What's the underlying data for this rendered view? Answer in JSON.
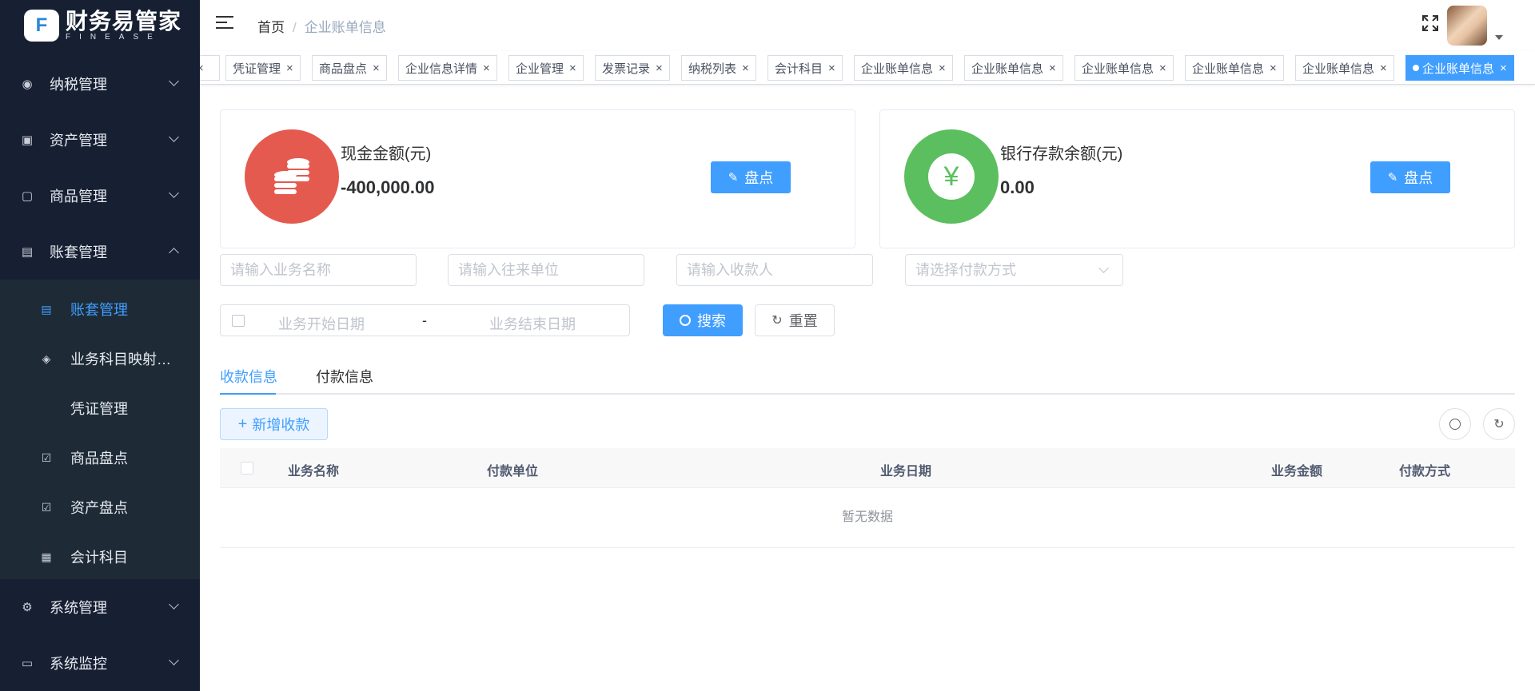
{
  "app": {
    "logo_letter": "F",
    "title": "财务易管家",
    "subtitle": "FINEASE"
  },
  "sidebar": {
    "menus": [
      {
        "label": "纳税管理",
        "icon": "eye-icon"
      },
      {
        "label": "资产管理",
        "icon": "camera-icon"
      },
      {
        "label": "商品管理",
        "icon": "image-icon"
      },
      {
        "label": "账套管理",
        "icon": "ledger-icon"
      },
      {
        "label": "系统管理",
        "icon": "gear-icon"
      },
      {
        "label": "系统监控",
        "icon": "monitor-icon"
      }
    ],
    "sub_items": [
      {
        "label": "账套管理",
        "icon": "ledger-icon"
      },
      {
        "label": "业务科目映射…",
        "icon": "layers-icon"
      },
      {
        "label": "凭证管理",
        "icon": ""
      },
      {
        "label": "商品盘点",
        "icon": "checkbox-icon"
      },
      {
        "label": "资产盘点",
        "icon": "checkbox-icon"
      },
      {
        "label": "会计科目",
        "icon": "calculator-icon"
      }
    ]
  },
  "header": {
    "breadcrumb": [
      "首页",
      "企业账单信息"
    ],
    "separator": "/"
  },
  "tags": [
    {
      "label": ""
    },
    {
      "label": "凭证管理"
    },
    {
      "label": "商品盘点"
    },
    {
      "label": "企业信息详情"
    },
    {
      "label": "企业管理"
    },
    {
      "label": "发票记录"
    },
    {
      "label": "纳税列表"
    },
    {
      "label": "会计科目"
    },
    {
      "label": "企业账单信息"
    },
    {
      "label": "企业账单信息"
    },
    {
      "label": "企业账单信息"
    },
    {
      "label": "企业账单信息"
    },
    {
      "label": "企业账单信息"
    },
    {
      "label": "企业账单信息",
      "active": true
    }
  ],
  "tag_close": "×",
  "cards": {
    "cash": {
      "label": "现金金额(元)",
      "value": "-400,000.00",
      "button": "盘点",
      "color": "#e55a4f"
    },
    "bank": {
      "label": "银行存款余额(元)",
      "value": "0.00",
      "button": "盘点",
      "color": "#5cbf5f",
      "symbol": "¥"
    }
  },
  "search": {
    "biz_name_placeholder": "请输入业务名称",
    "partner_placeholder": "请输入往来单位",
    "payee_placeholder": "请输入收款人",
    "pay_method_placeholder": "请选择付款方式",
    "start_date_placeholder": "业务开始日期",
    "date_separator": "-",
    "end_date_placeholder": "业务结束日期",
    "search_button": "搜索",
    "reset_button": "重置"
  },
  "tabs": [
    {
      "label": "收款信息",
      "active": true
    },
    {
      "label": "付款信息"
    }
  ],
  "toolbar": {
    "add_button": "新增收款",
    "add_symbol": "+"
  },
  "table": {
    "columns": [
      "业务名称",
      "付款单位",
      "业务日期",
      "业务金额",
      "付款方式"
    ],
    "empty_text": "暂无数据"
  },
  "colors": {
    "primary": "#409eff",
    "sidebar": "#172033",
    "submenu": "#1e2b37"
  }
}
